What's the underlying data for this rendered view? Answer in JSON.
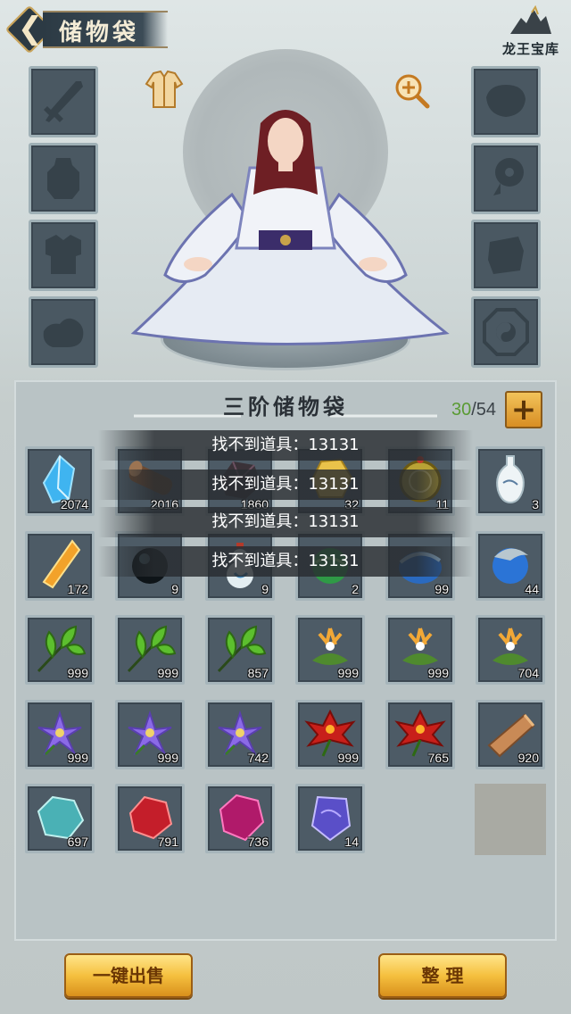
{
  "header": {
    "back_icon": "chevron-left-icon",
    "title": "储物袋",
    "brand": "龙王宝库"
  },
  "equipment": {
    "left_slots": [
      "sword-icon",
      "helmet-icon",
      "armor-icon",
      "boots-icon"
    ],
    "right_slots": [
      "ring-icon",
      "amulet-icon",
      "bracer-icon",
      "bagua-icon"
    ],
    "outfit_icon": "robe-icon",
    "zoom_icon": "zoom-in-icon"
  },
  "inventory": {
    "title": "三阶储物袋",
    "used": "30",
    "capacity": "/54",
    "add_icon": "plus-icon",
    "items": [
      {
        "icon": "blue-crystal-icon",
        "qty": "2074"
      },
      {
        "icon": "wood-log-icon",
        "qty": "2016"
      },
      {
        "icon": "dark-ore-icon",
        "qty": "1860"
      },
      {
        "icon": "gold-nugget-icon",
        "qty": "32"
      },
      {
        "icon": "gold-coin-icon",
        "qty": "11"
      },
      {
        "icon": "white-vase-icon",
        "qty": "3"
      },
      {
        "icon": "amber-crystal-icon",
        "qty": "172"
      },
      {
        "icon": "black-orb-icon",
        "qty": "9"
      },
      {
        "icon": "potion-gourd-icon",
        "qty": "9"
      },
      {
        "icon": "green-orb-icon",
        "qty": "2"
      },
      {
        "icon": "blue-beast-orb-icon",
        "qty": "99"
      },
      {
        "icon": "blue-spirit-orb-icon",
        "qty": "44"
      },
      {
        "icon": "green-herb-icon",
        "qty": "999"
      },
      {
        "icon": "green-herb-icon",
        "qty": "999"
      },
      {
        "icon": "green-herb-icon",
        "qty": "857"
      },
      {
        "icon": "lily-flower-icon",
        "qty": "999"
      },
      {
        "icon": "lily-flower-icon",
        "qty": "999"
      },
      {
        "icon": "lily-flower-icon",
        "qty": "704"
      },
      {
        "icon": "purple-flower-icon",
        "qty": "999"
      },
      {
        "icon": "purple-flower-icon",
        "qty": "999"
      },
      {
        "icon": "purple-flower-icon",
        "qty": "742"
      },
      {
        "icon": "red-lotus-icon",
        "qty": "999"
      },
      {
        "icon": "red-lotus-icon",
        "qty": "765"
      },
      {
        "icon": "copper-ingot-icon",
        "qty": "920"
      },
      {
        "icon": "teal-stone-icon",
        "qty": "697"
      },
      {
        "icon": "red-gem-icon",
        "qty": "791"
      },
      {
        "icon": "magenta-gem-icon",
        "qty": "736"
      },
      {
        "icon": "violet-crystal-icon",
        "qty": "14"
      }
    ]
  },
  "toasts": [
    "找不到道具：13131",
    "找不到道具：13131",
    "找不到道具：13131",
    "找不到道具：13131"
  ],
  "actions": {
    "sell_all": "一键出售",
    "sort": "整 理"
  }
}
